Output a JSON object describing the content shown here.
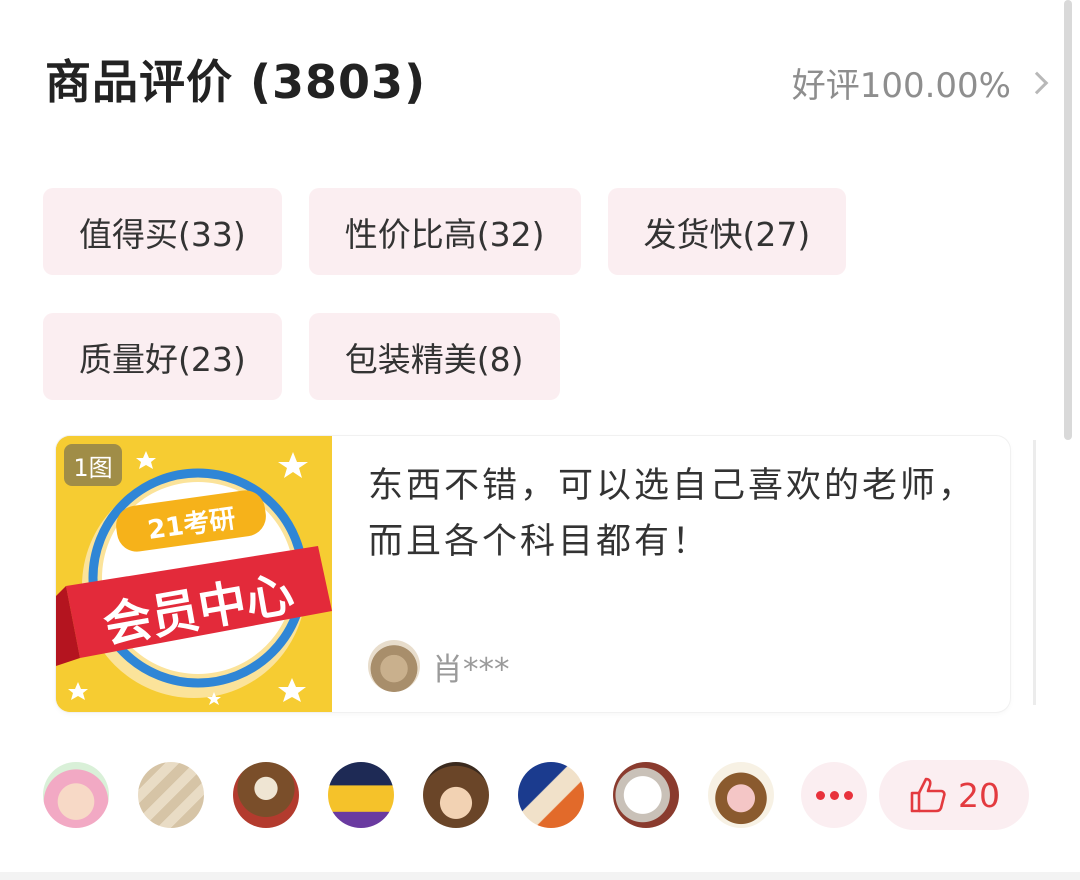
{
  "header": {
    "title": "商品评价 (3803)",
    "rating": "好评100.00%",
    "chevron_icon": "chevron-right-icon"
  },
  "tags": [
    [
      "值得买(33)",
      "性价比高(32)",
      "发货快(27)"
    ],
    [
      "质量好(23)",
      "包装精美(8)"
    ]
  ],
  "review": {
    "image_badge": "1图",
    "image": {
      "top_label": "21考研",
      "banner_text": "会员中心"
    },
    "text": "东西不错，可以选自己喜欢的老师，而且各个科目都有！",
    "reviewer_name": "肖***"
  },
  "bottom": {
    "like_count": "20",
    "more_icon": "more-dots-icon",
    "like_icon": "thumbs-up-icon"
  },
  "colors": {
    "tag_bg": "#fbeef1",
    "accent_red": "#e33a3f",
    "thumb_yellow": "#f6cc32"
  }
}
